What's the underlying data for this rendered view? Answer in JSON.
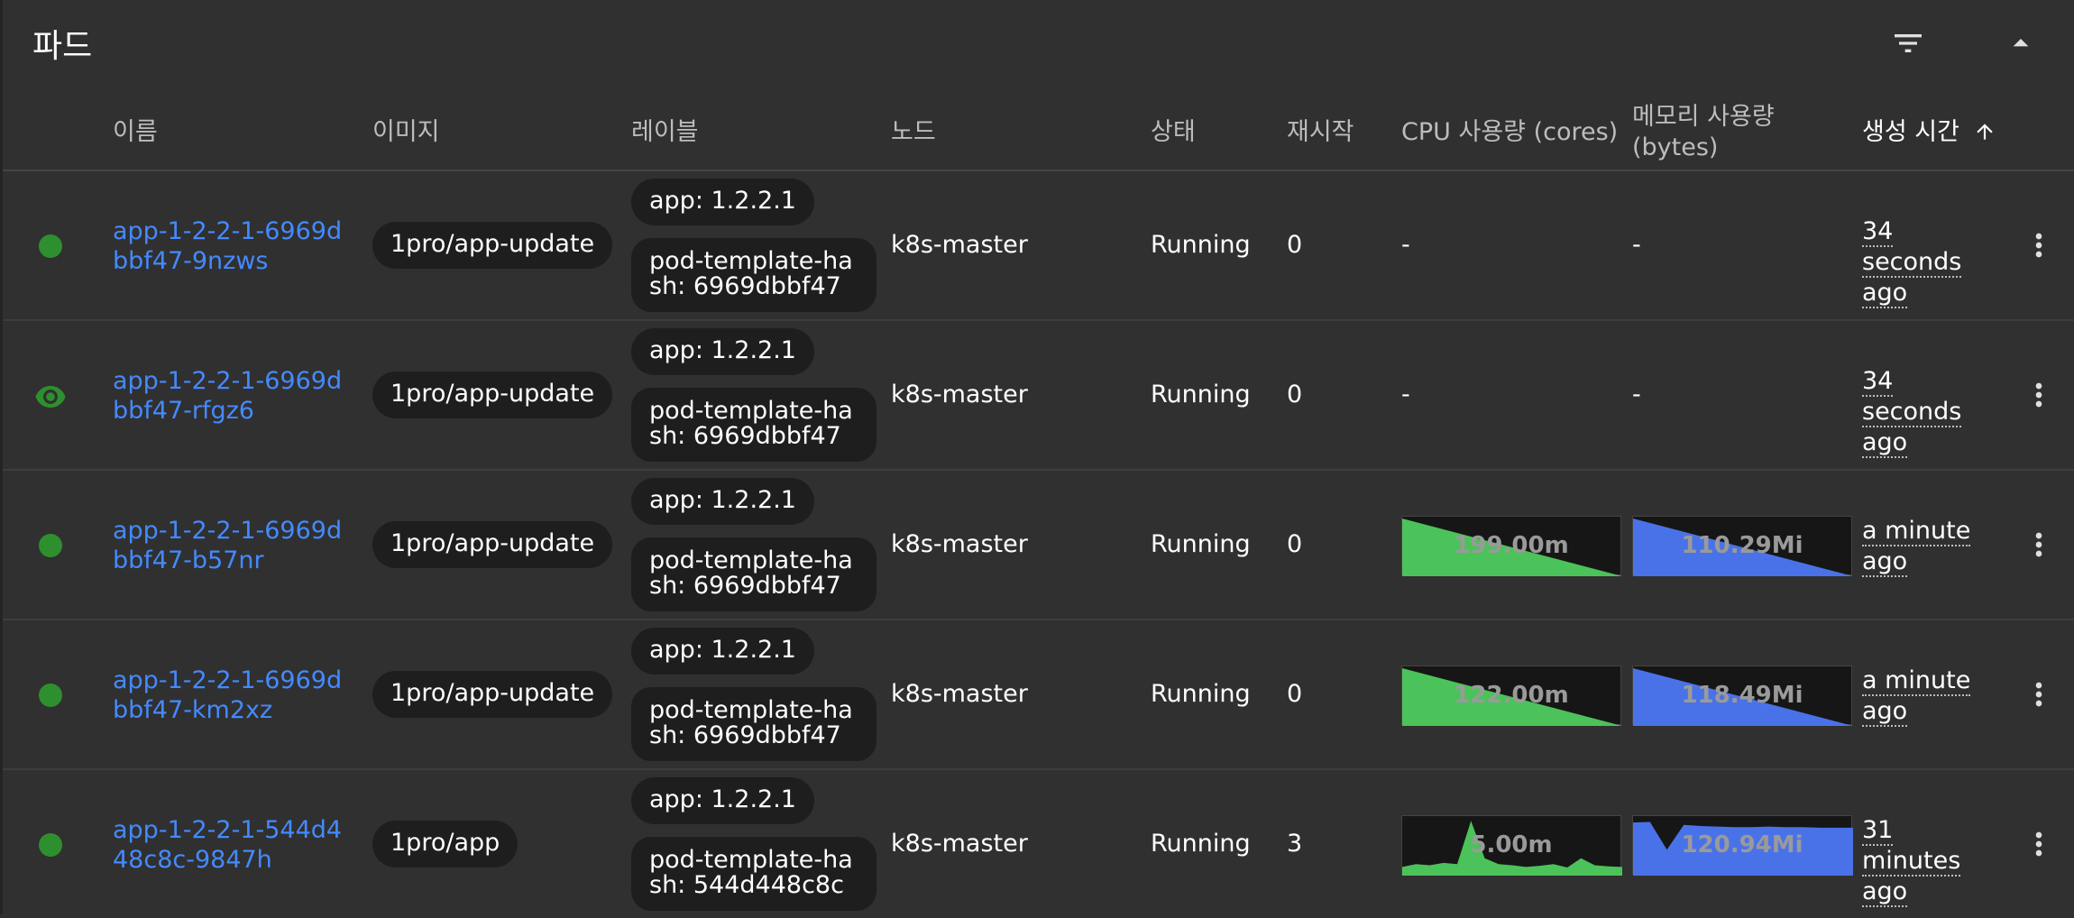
{
  "card": {
    "title": "파드"
  },
  "icons": {
    "filter": "filter-icon",
    "collapse": "caret-up-icon",
    "sort": "arrow-up-icon",
    "menu": "more-vert-icon",
    "eye": "eye-icon"
  },
  "columns": {
    "name": "이름",
    "image": "이미지",
    "labels": "레이블",
    "node": "노드",
    "status": "상태",
    "restarts": "재시작",
    "cpu": "CPU 사용량 (cores)",
    "memory_line1": "메모리 사용량",
    "memory_line2": "(bytes)",
    "created": "생성 시간"
  },
  "colors": {
    "link": "#448aff",
    "running": "#2e8f2e",
    "cpu_spark": "#4cc25a",
    "mem_spark": "#4a72e8"
  },
  "rows": [
    {
      "status_icon": "dot",
      "name": "app-1-2-2-1-6969dbbf47-9nzws",
      "image": "1pro/app-update",
      "label1": "app: 1.2.2.1",
      "label2": "pod-template-hash: 6969dbbf47",
      "node": "k8s-master",
      "status": "Running",
      "restarts": "0",
      "cpu": "-",
      "memory": "-",
      "age": "34 seconds ago"
    },
    {
      "status_icon": "eye",
      "name": "app-1-2-2-1-6969dbbf47-rfgz6",
      "image": "1pro/app-update",
      "label1": "app: 1.2.2.1",
      "label2": "pod-template-hash: 6969dbbf47",
      "node": "k8s-master",
      "status": "Running",
      "restarts": "0",
      "cpu": "-",
      "memory": "-",
      "age": "34 seconds ago"
    },
    {
      "status_icon": "dot",
      "name": "app-1-2-2-1-6969dbbf47-b57nr",
      "image": "1pro/app-update",
      "label1": "app: 1.2.2.1",
      "label2": "pod-template-hash: 6969dbbf47",
      "node": "k8s-master",
      "status": "Running",
      "restarts": "0",
      "cpu": "199.00m",
      "memory": "110.29Mi",
      "cpu_series": [
        1,
        0
      ],
      "mem_series": [
        1,
        0
      ],
      "age": "a minute ago"
    },
    {
      "status_icon": "dot",
      "name": "app-1-2-2-1-6969dbbf47-km2xz",
      "image": "1pro/app-update",
      "label1": "app: 1.2.2.1",
      "label2": "pod-template-hash: 6969dbbf47",
      "node": "k8s-master",
      "status": "Running",
      "restarts": "0",
      "cpu": "122.00m",
      "memory": "118.49Mi",
      "cpu_series": [
        1,
        0
      ],
      "mem_series": [
        1,
        0
      ],
      "age": "a minute ago"
    },
    {
      "status_icon": "dot",
      "name": "app-1-2-2-1-544d448c8c-9847h",
      "image": "1pro/app",
      "label1": "app: 1.2.2.1",
      "label2": "pod-template-hash: 544d448c8c",
      "node": "k8s-master",
      "status": "Running",
      "restarts": "3",
      "cpu": "5.00m",
      "memory": "120.94Mi",
      "cpu_series": [
        0.15,
        0.2,
        0.18,
        0.22,
        0.2,
        0.95,
        0.3,
        0.2,
        0.18,
        0.15,
        0.17,
        0.2,
        0.14,
        0.3,
        0.18,
        0.16,
        0.15
      ],
      "mem_series": [
        0.92,
        0.93,
        0.45,
        0.88,
        0.86,
        0.85,
        0.84,
        0.84,
        0.85,
        0.84,
        0.84,
        0.83,
        0.83,
        0.83
      ],
      "age": "31 minutes ago"
    }
  ]
}
